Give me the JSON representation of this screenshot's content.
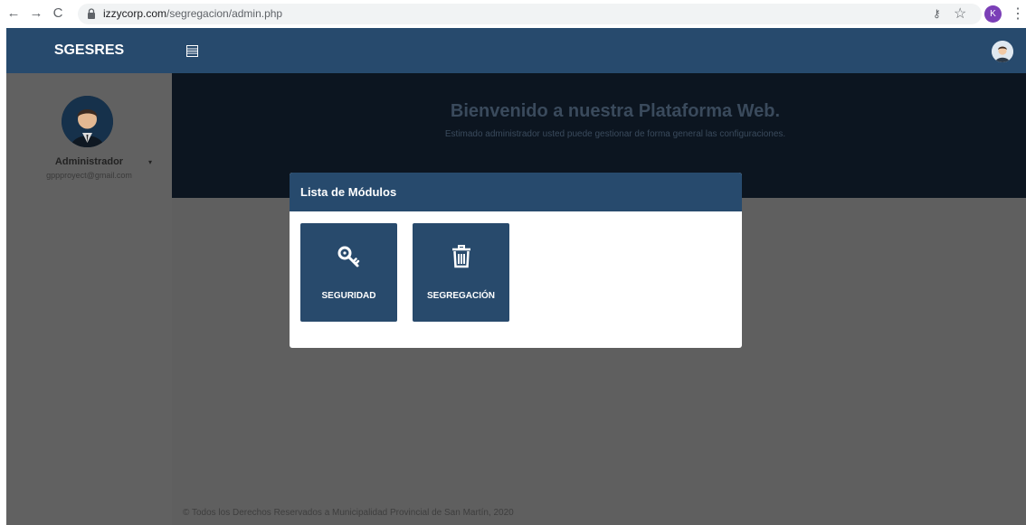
{
  "browser": {
    "url_host": "izzycorp.com",
    "url_path": "/segregacion/admin.php",
    "profile_initial": "K",
    "icons": [
      "back-arrow-icon",
      "forward-arrow-icon",
      "reload-icon",
      "lock-icon",
      "key-icon",
      "star-icon",
      "more-vert-icon"
    ]
  },
  "header": {
    "brand": "SGESRES",
    "menu_icon": "hamburger-icon",
    "avatar_icon": "user-avatar-icon"
  },
  "sidebar": {
    "user_name": "Administrador",
    "user_email": "gppproyect@gmail.com",
    "caret": "▾"
  },
  "hero": {
    "title": "Bienvenido a nuestra Plataforma Web.",
    "subtitle": "Estimado administrador usted puede gestionar de forma general las configuraciones."
  },
  "modal": {
    "title": "Lista de Módulos",
    "modules": [
      {
        "label": "SEGURIDAD",
        "icon": "key-icon"
      },
      {
        "label": "SEGREGACIÓN",
        "icon": "trash-icon"
      }
    ]
  },
  "footer": {
    "text": "© Todos los Derechos Reservados a Municipalidad Provincial de San Martín, 2020"
  },
  "colors": {
    "primary": "#274a6d",
    "overlay_dark": "#0c1520",
    "backdrop": "#5f5f5f",
    "white": "#ffffff"
  }
}
